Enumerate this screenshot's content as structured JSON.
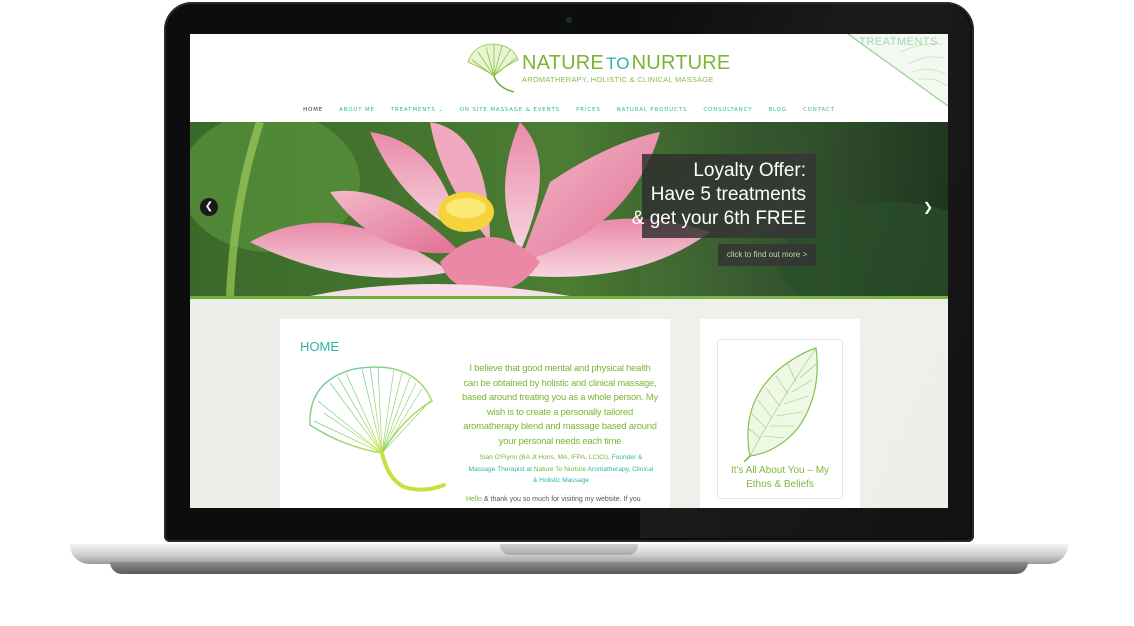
{
  "site": {
    "logo_title_a": "NATURE",
    "logo_title_to": "TO",
    "logo_title_b": "NURTURE",
    "logo_subtitle": "AROMATHERAPY, HOLISTIC & CLINICAL MASSAGE",
    "corner_label": "TREATMENTS"
  },
  "nav": {
    "items": [
      {
        "label": "HOME",
        "active": true
      },
      {
        "label": "ABOUT ME"
      },
      {
        "label": "TREATMENTS ⌄"
      },
      {
        "label": "ON SITE MASSAGE & EVENTS"
      },
      {
        "label": "PRICES"
      },
      {
        "label": "NATURAL PRODUCTS"
      },
      {
        "label": "CONSULTANCY"
      },
      {
        "label": "BLOG"
      },
      {
        "label": "CONTACT"
      }
    ]
  },
  "slider": {
    "line1": "Loyalty Offer:",
    "line2": "Have 5 treatments",
    "line3": "& get your 6th FREE",
    "button": "click to find out more >",
    "prev_icon": "chevron-left-icon",
    "next_icon": "chevron-right-icon"
  },
  "main": {
    "title": "HOME",
    "quote": "I believe that good mental and physical health can be obtained by holistic and clinical massage, based around treating you as a whole person. My wish is to create a personally tailored aromatherapy blend and massage based around your personal needs each time",
    "sig_name": "Sian O'Flynn (BA Jt Hons, MA, IFPA, LCICI),",
    "sig_role": "Founder & Massage Therapist at",
    "sig_company": "Nature To Nurture",
    "sig_tail": "Aromatherapy, Clinical & Holistic Massage",
    "hello_word": "Hello",
    "hello_rest": "& thank you so much for visiting my website. If you"
  },
  "sidebar": {
    "caption": "It's All About You – My Ethos & Beliefs"
  },
  "colors": {
    "brand_green": "#7ab432",
    "brand_teal": "#2db3a6"
  }
}
